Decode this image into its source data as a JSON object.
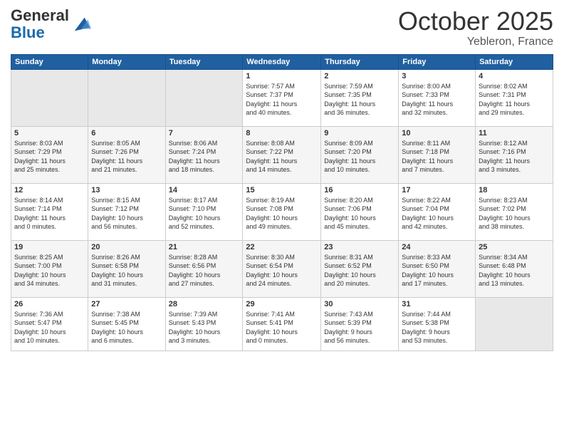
{
  "header": {
    "logo_line1": "General",
    "logo_line2": "Blue",
    "month": "October 2025",
    "location": "Yebleron, France"
  },
  "weekdays": [
    "Sunday",
    "Monday",
    "Tuesday",
    "Wednesday",
    "Thursday",
    "Friday",
    "Saturday"
  ],
  "weeks": [
    [
      {
        "day": "",
        "info": ""
      },
      {
        "day": "",
        "info": ""
      },
      {
        "day": "",
        "info": ""
      },
      {
        "day": "1",
        "info": "Sunrise: 7:57 AM\nSunset: 7:37 PM\nDaylight: 11 hours\nand 40 minutes."
      },
      {
        "day": "2",
        "info": "Sunrise: 7:59 AM\nSunset: 7:35 PM\nDaylight: 11 hours\nand 36 minutes."
      },
      {
        "day": "3",
        "info": "Sunrise: 8:00 AM\nSunset: 7:33 PM\nDaylight: 11 hours\nand 32 minutes."
      },
      {
        "day": "4",
        "info": "Sunrise: 8:02 AM\nSunset: 7:31 PM\nDaylight: 11 hours\nand 29 minutes."
      }
    ],
    [
      {
        "day": "5",
        "info": "Sunrise: 8:03 AM\nSunset: 7:29 PM\nDaylight: 11 hours\nand 25 minutes."
      },
      {
        "day": "6",
        "info": "Sunrise: 8:05 AM\nSunset: 7:26 PM\nDaylight: 11 hours\nand 21 minutes."
      },
      {
        "day": "7",
        "info": "Sunrise: 8:06 AM\nSunset: 7:24 PM\nDaylight: 11 hours\nand 18 minutes."
      },
      {
        "day": "8",
        "info": "Sunrise: 8:08 AM\nSunset: 7:22 PM\nDaylight: 11 hours\nand 14 minutes."
      },
      {
        "day": "9",
        "info": "Sunrise: 8:09 AM\nSunset: 7:20 PM\nDaylight: 11 hours\nand 10 minutes."
      },
      {
        "day": "10",
        "info": "Sunrise: 8:11 AM\nSunset: 7:18 PM\nDaylight: 11 hours\nand 7 minutes."
      },
      {
        "day": "11",
        "info": "Sunrise: 8:12 AM\nSunset: 7:16 PM\nDaylight: 11 hours\nand 3 minutes."
      }
    ],
    [
      {
        "day": "12",
        "info": "Sunrise: 8:14 AM\nSunset: 7:14 PM\nDaylight: 11 hours\nand 0 minutes."
      },
      {
        "day": "13",
        "info": "Sunrise: 8:15 AM\nSunset: 7:12 PM\nDaylight: 10 hours\nand 56 minutes."
      },
      {
        "day": "14",
        "info": "Sunrise: 8:17 AM\nSunset: 7:10 PM\nDaylight: 10 hours\nand 52 minutes."
      },
      {
        "day": "15",
        "info": "Sunrise: 8:19 AM\nSunset: 7:08 PM\nDaylight: 10 hours\nand 49 minutes."
      },
      {
        "day": "16",
        "info": "Sunrise: 8:20 AM\nSunset: 7:06 PM\nDaylight: 10 hours\nand 45 minutes."
      },
      {
        "day": "17",
        "info": "Sunrise: 8:22 AM\nSunset: 7:04 PM\nDaylight: 10 hours\nand 42 minutes."
      },
      {
        "day": "18",
        "info": "Sunrise: 8:23 AM\nSunset: 7:02 PM\nDaylight: 10 hours\nand 38 minutes."
      }
    ],
    [
      {
        "day": "19",
        "info": "Sunrise: 8:25 AM\nSunset: 7:00 PM\nDaylight: 10 hours\nand 34 minutes."
      },
      {
        "day": "20",
        "info": "Sunrise: 8:26 AM\nSunset: 6:58 PM\nDaylight: 10 hours\nand 31 minutes."
      },
      {
        "day": "21",
        "info": "Sunrise: 8:28 AM\nSunset: 6:56 PM\nDaylight: 10 hours\nand 27 minutes."
      },
      {
        "day": "22",
        "info": "Sunrise: 8:30 AM\nSunset: 6:54 PM\nDaylight: 10 hours\nand 24 minutes."
      },
      {
        "day": "23",
        "info": "Sunrise: 8:31 AM\nSunset: 6:52 PM\nDaylight: 10 hours\nand 20 minutes."
      },
      {
        "day": "24",
        "info": "Sunrise: 8:33 AM\nSunset: 6:50 PM\nDaylight: 10 hours\nand 17 minutes."
      },
      {
        "day": "25",
        "info": "Sunrise: 8:34 AM\nSunset: 6:48 PM\nDaylight: 10 hours\nand 13 minutes."
      }
    ],
    [
      {
        "day": "26",
        "info": "Sunrise: 7:36 AM\nSunset: 5:47 PM\nDaylight: 10 hours\nand 10 minutes."
      },
      {
        "day": "27",
        "info": "Sunrise: 7:38 AM\nSunset: 5:45 PM\nDaylight: 10 hours\nand 6 minutes."
      },
      {
        "day": "28",
        "info": "Sunrise: 7:39 AM\nSunset: 5:43 PM\nDaylight: 10 hours\nand 3 minutes."
      },
      {
        "day": "29",
        "info": "Sunrise: 7:41 AM\nSunset: 5:41 PM\nDaylight: 10 hours\nand 0 minutes."
      },
      {
        "day": "30",
        "info": "Sunrise: 7:43 AM\nSunset: 5:39 PM\nDaylight: 9 hours\nand 56 minutes."
      },
      {
        "day": "31",
        "info": "Sunrise: 7:44 AM\nSunset: 5:38 PM\nDaylight: 9 hours\nand 53 minutes."
      },
      {
        "day": "",
        "info": ""
      }
    ]
  ]
}
